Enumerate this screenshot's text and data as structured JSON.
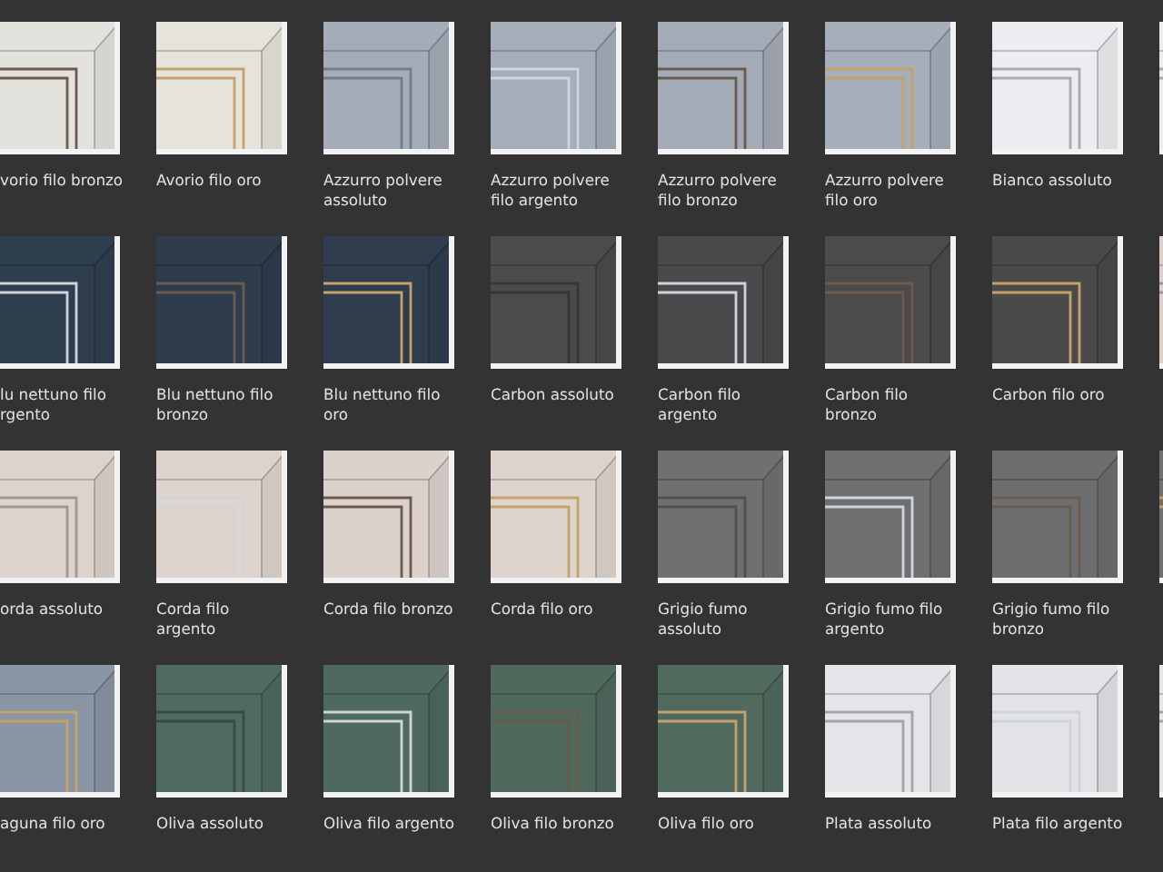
{
  "rows": [
    {
      "swatches": [
        {
          "label": [
            "vorio filo bronzo"
          ],
          "color": "#e4e2dd",
          "kind": "bronzo"
        },
        {
          "label": [
            "Avorio filo oro"
          ],
          "color": "#e6e3dc",
          "kind": "oro"
        },
        {
          "label": [
            "Azzurro polvere",
            "assoluto"
          ],
          "color": "#a3acb8",
          "kind": "assoluto"
        },
        {
          "label": [
            "Azzurro polvere",
            "filo argento"
          ],
          "color": "#a5adb9",
          "kind": "argento"
        },
        {
          "label": [
            "Azzurro polvere",
            "filo bronzo"
          ],
          "color": "#a3abb7",
          "kind": "bronzo"
        },
        {
          "label": [
            "Azzurro polvere",
            "filo oro"
          ],
          "color": "#a6aeba",
          "kind": "oro"
        },
        {
          "label": [
            "Bianco assoluto"
          ],
          "color": "#ededf1",
          "kind": "assoluto"
        },
        {
          "color": "#ededf1",
          "kind": "assoluto"
        }
      ]
    },
    {
      "swatches": [
        {
          "label": [
            "lu nettuno filo",
            "rgento"
          ],
          "color": "#2f3e4f",
          "kind": "argento"
        },
        {
          "label": [
            "Blu nettuno filo",
            "bronzo"
          ],
          "color": "#2e3c4c",
          "kind": "bronzo"
        },
        {
          "label": [
            "Blu nettuno filo",
            "oro"
          ],
          "color": "#2f3d4e",
          "kind": "oro"
        },
        {
          "label": [
            "Carbon assoluto"
          ],
          "color": "#4b4b4d",
          "kind": "assoluto"
        },
        {
          "label": [
            "Carbon filo",
            "argento"
          ],
          "color": "#4a4a4c",
          "kind": "argento"
        },
        {
          "label": [
            "Carbon filo",
            "bronzo"
          ],
          "color": "#4c4a4b",
          "kind": "bronzo"
        },
        {
          "label": [
            "Carbon filo oro"
          ],
          "color": "#4b4a4a",
          "kind": "oro"
        },
        {
          "color": "#dcd2cc",
          "kind": "assoluto"
        }
      ]
    },
    {
      "swatches": [
        {
          "label": [
            "orda assoluto"
          ],
          "color": "#ddd3cd",
          "kind": "assoluto"
        },
        {
          "label": [
            "Corda filo",
            "argento"
          ],
          "color": "#ddd4ce",
          "kind": "argento"
        },
        {
          "label": [
            "Corda filo bronzo"
          ],
          "color": "#dcd2cc",
          "kind": "bronzo"
        },
        {
          "label": [
            "Corda filo oro"
          ],
          "color": "#ded4ce",
          "kind": "oro"
        },
        {
          "label": [
            "Grigio fumo",
            "assoluto"
          ],
          "color": "#6e7072",
          "kind": "assoluto"
        },
        {
          "label": [
            "Grigio fumo filo",
            "argento"
          ],
          "color": "#6d6f71",
          "kind": "argento"
        },
        {
          "label": [
            "Grigio fumo filo",
            "bronzo"
          ],
          "color": "#6c6e70",
          "kind": "bronzo"
        },
        {
          "color": "#6d6f71",
          "kind": "oro"
        }
      ]
    },
    {
      "swatches": [
        {
          "label": [
            "aguna filo oro"
          ],
          "color": "#8a95a5",
          "kind": "oro"
        },
        {
          "label": [
            "Oliva assoluto"
          ],
          "color": "#4f6a5f",
          "kind": "assoluto"
        },
        {
          "label": [
            "Oliva filo argento"
          ],
          "color": "#4e695e",
          "kind": "argento"
        },
        {
          "label": [
            "Oliva filo bronzo"
          ],
          "color": "#4f695d",
          "kind": "bronzo"
        },
        {
          "label": [
            "Oliva filo oro"
          ],
          "color": "#506a5e",
          "kind": "oro"
        },
        {
          "label": [
            "Plata assoluto"
          ],
          "color": "#e4e5e9",
          "kind": "assoluto"
        },
        {
          "label": [
            "Plata filo argento"
          ],
          "color": "#e2e3e7",
          "kind": "argento"
        },
        {
          "color": "#e4e5e9",
          "kind": "assoluto"
        }
      ]
    }
  ]
}
